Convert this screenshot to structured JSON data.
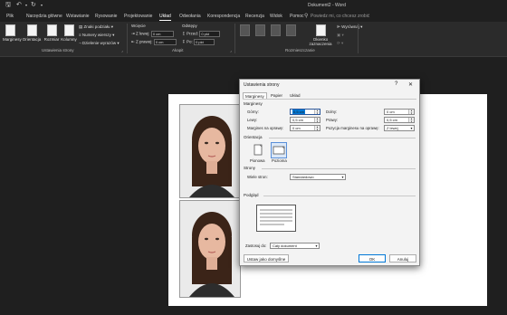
{
  "window": {
    "doc_title": "Dokument2  -  Word"
  },
  "tabs": [
    "Plik",
    "Narzędzia główne",
    "Wstawianie",
    "Rysowanie",
    "Projektowanie",
    "Układ",
    "Odwołania",
    "Korespondencja",
    "Recenzja",
    "Widok",
    "Pomoc"
  ],
  "active_tab": "Układ",
  "tell_me": "Powiedz mi, co chcesz zrobić",
  "ribbon": {
    "page_setup": {
      "margins": "Marginesy",
      "orientation": "Orientacja",
      "size": "Rozmiar",
      "columns": "Kolumny",
      "breaks": "Znaki podziału",
      "line_numbers": "Numery wierszy",
      "hyphenation": "Dzielenie wyrazów",
      "group_label": "Ustawienia strony"
    },
    "paragraph": {
      "indent_title": "Wcięcie",
      "left_label": "Z lewej:",
      "left_value": "0 cm",
      "right_label": "Z prawej:",
      "right_value": "0 cm",
      "spacing_title": "Odstępy",
      "before_label": "Przed:",
      "before_value": "0 pkt",
      "after_label": "Po:",
      "after_value": "0 pkt",
      "group_label": "Akapit"
    },
    "arrange": {
      "group_label": "Rozmieszczanie",
      "selection_pane": "Okienko zaznaczenia",
      "align": "Wyrównaj"
    }
  },
  "dialog": {
    "title": "Ustawienia strony",
    "help": "?",
    "close": "✕",
    "tabs": [
      "Marginesy",
      "Papier",
      "Układ"
    ],
    "margins_section": "Marginesy",
    "top_label": "Górny:",
    "top_value": "0,5 cm",
    "bottom_label": "Dolny:",
    "bottom_value": "0 cm",
    "left_label": "Lewy:",
    "left_value": "0,5 cm",
    "right_label": "Prawy:",
    "right_value": "0,5 cm",
    "gutter_label": "Margines na oprawę:",
    "gutter_value": "0 cm",
    "gutter_pos_label": "Pozycja marginesu na oprawę:",
    "gutter_pos_value": "Z lewej",
    "orientation_section": "Orientacja",
    "portrait": "Pionowa",
    "landscape": "Pozioma",
    "pages_section": "Strony",
    "multiple_pages_label": "Wiele stron:",
    "multiple_pages_value": "Standardowo",
    "preview_section": "Podgląd",
    "apply_to_label": "Zastosuj do:",
    "apply_to_value": "Cały dokument",
    "set_default": "Ustaw jako domyślne",
    "ok": "OK",
    "cancel": "Anuluj"
  }
}
